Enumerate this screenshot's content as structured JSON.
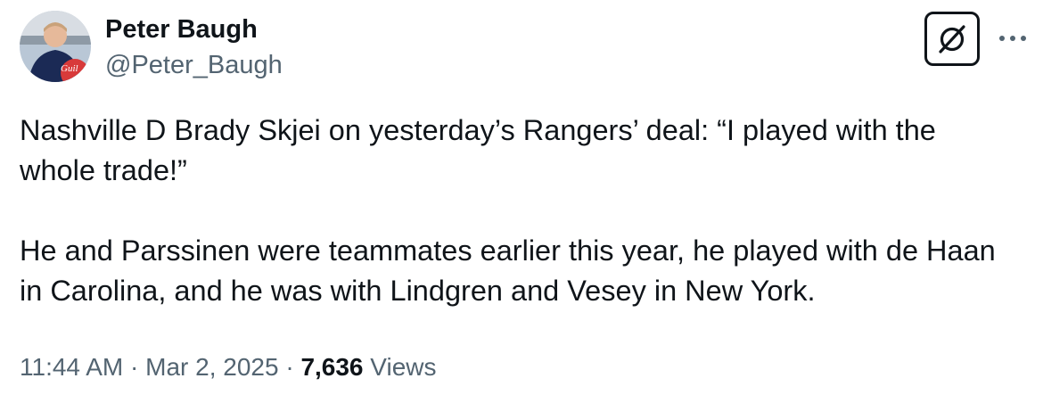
{
  "author": {
    "name": "Peter Baugh",
    "handle": "@Peter_Baugh",
    "avatar_badge_text": "Guil"
  },
  "actions": {
    "grok_icon": "slashed-circle-icon",
    "more_icon": "more-horizontal-icon"
  },
  "tweet": {
    "paragraphs": [
      "Nashville D Brady Skjei on yesterday’s Rangers’ deal: “I played with the whole trade!”",
      "He and Parssinen were teammates earlier this year, he played with de Haan in Carolina, and he was with Lindgren and Vesey in New York."
    ]
  },
  "meta": {
    "time": "11:44 AM",
    "separator": "·",
    "date": "Mar 2, 2025",
    "views_count": "7,636",
    "views_label": "Views"
  },
  "colors": {
    "text_primary": "#0f1419",
    "text_secondary": "#536471",
    "background": "#ffffff"
  }
}
